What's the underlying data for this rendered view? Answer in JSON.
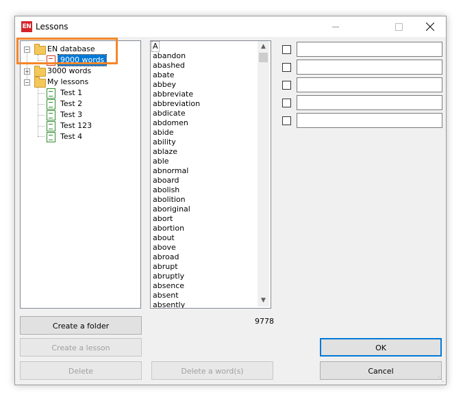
{
  "window": {
    "title": "Lessons",
    "app_icon_text": "EN"
  },
  "tree": {
    "nodes": [
      {
        "label": "EN database",
        "type": "folder",
        "expander": "−"
      },
      {
        "label": "9000 words",
        "type": "database",
        "selected": true
      },
      {
        "label": "3000 words",
        "type": "folder",
        "expander": "+"
      },
      {
        "label": "My lessons",
        "type": "folder",
        "expander": "−"
      },
      {
        "label": "Test 1",
        "type": "lesson"
      },
      {
        "label": "Test 2",
        "type": "lesson"
      },
      {
        "label": "Test 3",
        "type": "lesson"
      },
      {
        "label": "Test 123",
        "type": "lesson"
      },
      {
        "label": "Test 4",
        "type": "lesson"
      }
    ]
  },
  "wordlist": {
    "words": [
      "A",
      "abandon",
      "abashed",
      "abate",
      "abbey",
      "abbreviate",
      "abbreviation",
      "abdicate",
      "abdomen",
      "abide",
      "ability",
      "ablaze",
      "able",
      "abnormal",
      "aboard",
      "abolish",
      "abolition",
      "aboriginal",
      "abort",
      "abortion",
      "about",
      "above",
      "abroad",
      "abrupt",
      "abruptly",
      "absence",
      "absent",
      "absently"
    ],
    "count": "9778"
  },
  "fields": {
    "rows": [
      {
        "checked": false,
        "value": ""
      },
      {
        "checked": false,
        "value": ""
      },
      {
        "checked": false,
        "value": ""
      },
      {
        "checked": false,
        "value": ""
      },
      {
        "checked": false,
        "value": ""
      }
    ]
  },
  "buttons": {
    "create_folder": "Create a folder",
    "create_lesson": "Create a lesson",
    "delete": "Delete",
    "delete_word": "Delete a word(s)",
    "ok": "OK",
    "cancel": "Cancel"
  },
  "colors": {
    "selection": "#0078d7",
    "highlight_outline": "#f5862a",
    "app_icon": "#d4232b"
  }
}
